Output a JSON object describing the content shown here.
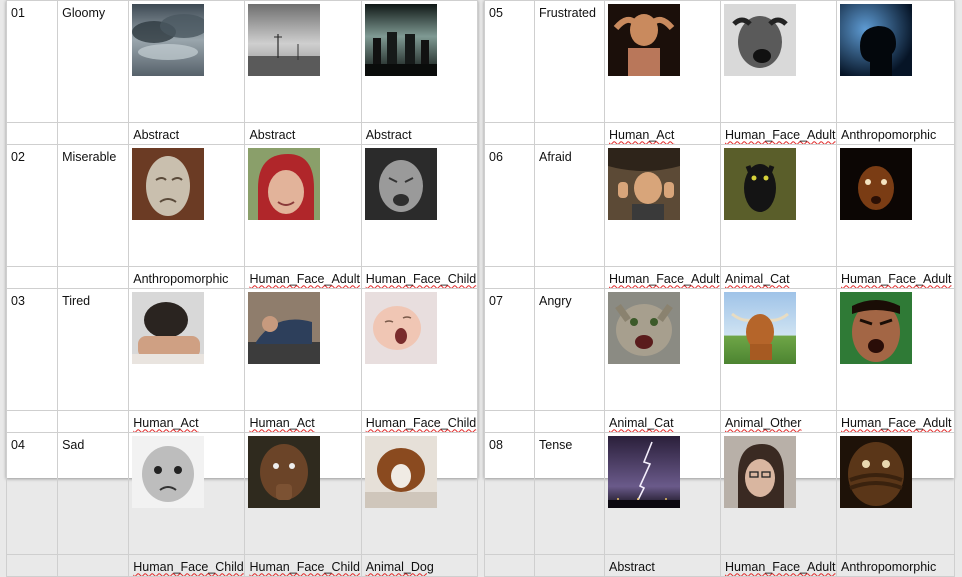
{
  "left_table": [
    {
      "number": "01",
      "emotion": "Gloomy",
      "images": [
        {
          "icon": "storm-clouds-photo",
          "label": "Abstract",
          "squiggle": false
        },
        {
          "icon": "foggy-landscape-photo",
          "label": "Abstract",
          "squiggle": false
        },
        {
          "icon": "industrial-skyline-photo",
          "label": "Abstract",
          "squiggle": false
        }
      ]
    },
    {
      "number": "02",
      "emotion": "Miserable",
      "images": [
        {
          "icon": "crying-mask-photo",
          "label": "Anthropomorphic",
          "squiggle": false
        },
        {
          "icon": "crying-woman-photo",
          "label": "Human_Face_Adult",
          "squiggle": true
        },
        {
          "icon": "crying-child-photo",
          "label": "Human_Face_Child",
          "squiggle": true
        }
      ]
    },
    {
      "number": "03",
      "emotion": "Tired",
      "images": [
        {
          "icon": "head-down-man-photo",
          "label": "Human_Act",
          "squiggle": true
        },
        {
          "icon": "sleeping-person-photo",
          "label": "Human_Act",
          "squiggle": true
        },
        {
          "icon": "yawning-baby-photo",
          "label": "Human_Face_Child",
          "squiggle": true
        }
      ]
    },
    {
      "number": "04",
      "emotion": "Sad",
      "images": [
        {
          "icon": "sad-baby-photo",
          "label": "Human_Face_Child",
          "squiggle": true
        },
        {
          "icon": "sad-boy-photo",
          "label": "Human_Face_Child",
          "squiggle": true
        },
        {
          "icon": "sad-puppy-photo",
          "label": "Animal_Dog",
          "squiggle": true
        }
      ]
    }
  ],
  "right_table": [
    {
      "number": "05",
      "emotion": "Frustrated",
      "images": [
        {
          "icon": "hands-on-head-woman-photo",
          "label": "Human_Act",
          "squiggle": true
        },
        {
          "icon": "screaming-man-photo",
          "label": "Human_Face_Adult",
          "squiggle": true
        },
        {
          "icon": "silhouette-head-photo",
          "label": "Anthropomorphic",
          "squiggle": false
        }
      ]
    },
    {
      "number": "06",
      "emotion": "Afraid",
      "images": [
        {
          "icon": "scared-man-cave-photo",
          "label": "Human_Face_Adult",
          "squiggle": true
        },
        {
          "icon": "black-cat-photo",
          "label": "Animal_Cat",
          "squiggle": true
        },
        {
          "icon": "dark-face-photo",
          "label": "Human_Face_Adult",
          "squiggle": true
        }
      ]
    },
    {
      "number": "07",
      "emotion": "Angry",
      "images": [
        {
          "icon": "hissing-cat-photo",
          "label": "Animal_Cat",
          "squiggle": true
        },
        {
          "icon": "highland-cow-photo",
          "label": "Animal_Other",
          "squiggle": true
        },
        {
          "icon": "angry-man-photo",
          "label": "Human_Face_Adult",
          "squiggle": true
        }
      ]
    },
    {
      "number": "08",
      "emotion": "Tense",
      "images": [
        {
          "icon": "lightning-sky-photo",
          "label": "Abstract",
          "squiggle": false
        },
        {
          "icon": "worried-woman-photo",
          "label": "Human_Face_Adult",
          "squiggle": true
        },
        {
          "icon": "covered-face-photo",
          "label": "Anthropomorphic",
          "squiggle": false
        }
      ]
    }
  ]
}
